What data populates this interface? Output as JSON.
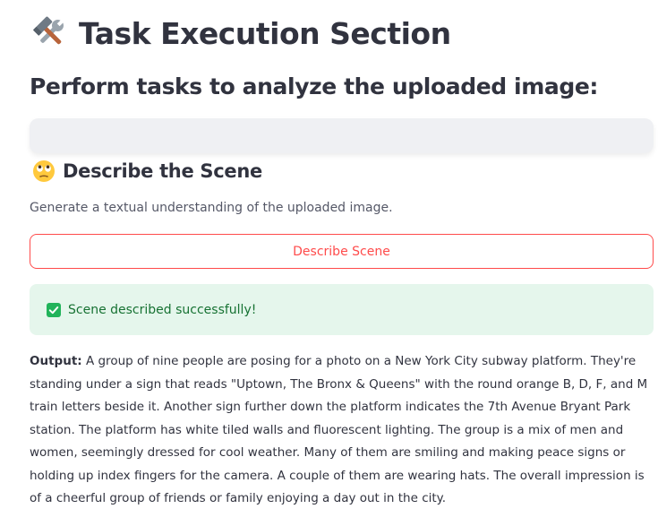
{
  "header": {
    "icon": "hammer-and-wrench-icon",
    "title": "Task Execution Section"
  },
  "subtitle": "Perform tasks to analyze the uploaded image:",
  "describe_section": {
    "icon": "face-with-rolling-eyes-icon",
    "title": "Describe the Scene",
    "caption": "Generate a textual understanding of the uploaded image.",
    "button_label": "Describe Scene"
  },
  "status": {
    "icon": "checkmark-box-icon",
    "message": "Scene described successfully!"
  },
  "output": {
    "label": "Output:",
    "text": " A group of nine people are posing for a photo on a New York City subway platform. They're standing under a sign that reads \"Uptown, The Bronx & Queens\" with the round orange B, D, F, and M train letters beside it. Another sign further down the platform indicates the 7th Avenue Bryant Park station. The platform has white tiled walls and fluorescent lighting. The group is a mix of men and women, seemingly dressed for cool weather. Many of them are smiling and making peace signs or holding up index fingers for the camera. A couple of them are wearing hats. The overall impression is of a cheerful group of friends or family enjoying a day out in the city."
  },
  "colors": {
    "accent": "#ff4b4b",
    "success_bg": "#e5f6ec",
    "success_text": "#177233",
    "text": "#31333f"
  }
}
